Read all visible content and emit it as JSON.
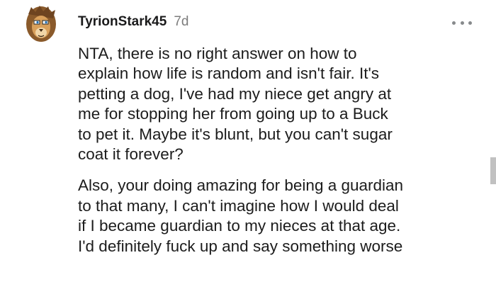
{
  "comment": {
    "author": "TyrionStark45",
    "age": "7d",
    "paragraphs": [
      "NTA, there is no right answer on how to\nexplain how life is random and isn't fair. It's\npetting a dog, I've had my niece get angry at\nme for stopping her from going up to a Buck\nto pet it. Maybe it's blunt, but you can't sugar\ncoat it forever?",
      "Also, your doing amazing for being a guardian\nto that many, I can't imagine how I would deal\nif I became guardian to my nieces at that age.\nI'd definitely fuck up and say something worse"
    ]
  },
  "icons": {
    "avatar": "lion-avatar-icon",
    "more": "more-options-icon"
  },
  "colors": {
    "text": "#1a1a1b",
    "meta": "#7c7c7c",
    "icon": "#878a8c"
  }
}
